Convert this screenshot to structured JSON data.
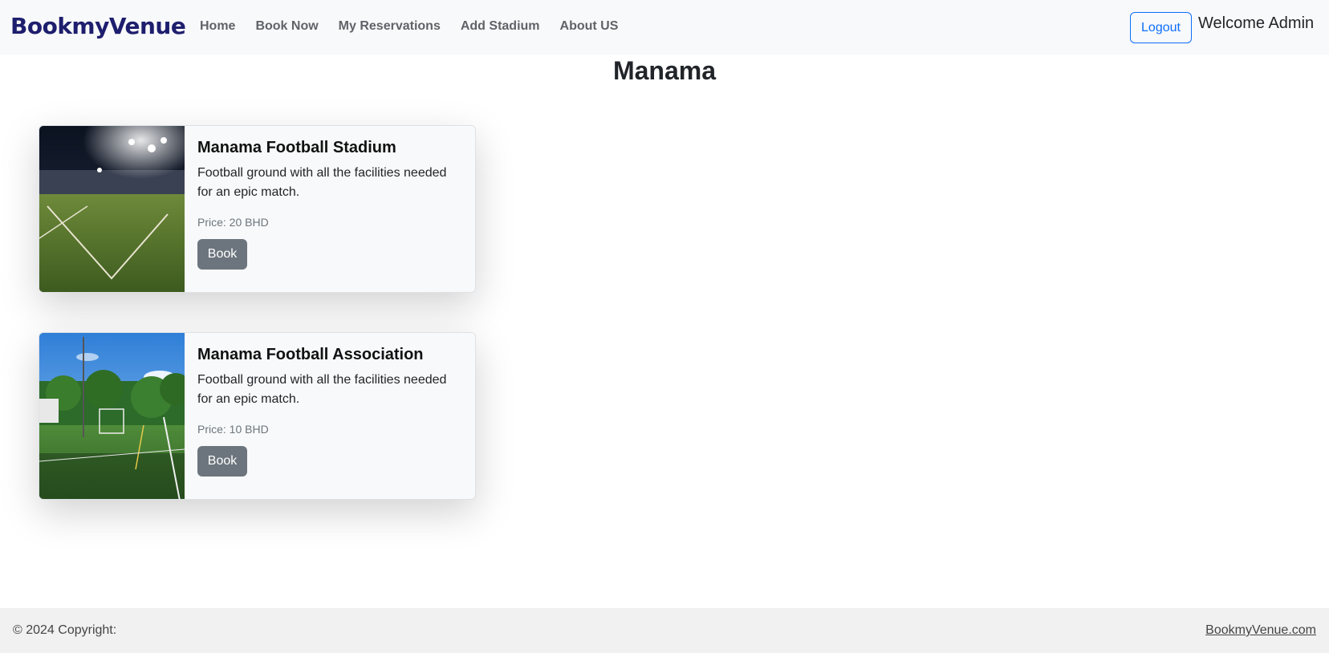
{
  "navbar": {
    "brand": "BookmyVenue",
    "links": [
      "Home",
      "Book Now",
      "My Reservations",
      "Add Stadium",
      "About US"
    ],
    "logout_label": "Logout",
    "welcome": "Welcome Admin"
  },
  "page": {
    "title": "Manama"
  },
  "venues": [
    {
      "name": "Manama Football Stadium",
      "description": "Football ground with all the facilities needed for an epic match.",
      "price": "Price: 20 BHD",
      "book_label": "Book"
    },
    {
      "name": "Manama Football Association",
      "description": "Football ground with all the facilities needed for an epic match.",
      "price": "Price: 10 BHD",
      "book_label": "Book"
    }
  ],
  "footer": {
    "copyright": "© 2024 Copyright:",
    "link": "BookmyVenue.com"
  }
}
